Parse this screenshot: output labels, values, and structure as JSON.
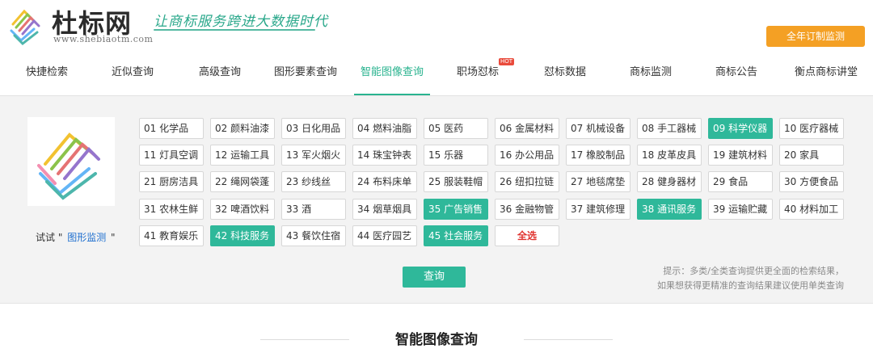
{
  "header": {
    "logo_title": "杜标网",
    "logo_domain": "www.shebiaotm.com",
    "slogan": "让商标服务跨进大数据时代",
    "cta_label": "全年订制监测"
  },
  "nav": {
    "items": [
      {
        "label": "快捷检索"
      },
      {
        "label": "近似查询"
      },
      {
        "label": "高级查询"
      },
      {
        "label": "图形要素查询"
      },
      {
        "label": "智能图像查询"
      },
      {
        "label": "职场怼标",
        "badge": "HOT"
      },
      {
        "label": "怼标数据"
      },
      {
        "label": "商标监测"
      },
      {
        "label": "商标公告"
      },
      {
        "label": "衡点商标讲堂"
      }
    ],
    "active_label": "智能图像查询"
  },
  "panel": {
    "try_prefix": "试试",
    "try_link": "图形监测",
    "categories": [
      {
        "label": "01 化学品"
      },
      {
        "label": "02 颜料油漆"
      },
      {
        "label": "03 日化用品"
      },
      {
        "label": "04 燃料油脂"
      },
      {
        "label": "05 医药"
      },
      {
        "label": "06 金属材料"
      },
      {
        "label": "07 机械设备"
      },
      {
        "label": "08 手工器械"
      },
      {
        "label": "09 科学仪器"
      },
      {
        "label": "10 医疗器械"
      },
      {
        "label": "11 灯具空调"
      },
      {
        "label": "12 运输工具"
      },
      {
        "label": "13 军火烟火"
      },
      {
        "label": "14 珠宝钟表"
      },
      {
        "label": "15 乐器"
      },
      {
        "label": "16 办公用品"
      },
      {
        "label": "17 橡胶制品"
      },
      {
        "label": "18 皮革皮具"
      },
      {
        "label": "19 建筑材料"
      },
      {
        "label": "20 家具"
      },
      {
        "label": "21 厨房洁具"
      },
      {
        "label": "22 绳网袋蓬"
      },
      {
        "label": "23 纱线丝"
      },
      {
        "label": "24 布料床单"
      },
      {
        "label": "25 服装鞋帽"
      },
      {
        "label": "26 纽扣拉链"
      },
      {
        "label": "27 地毯席垫"
      },
      {
        "label": "28 健身器材"
      },
      {
        "label": "29 食品"
      },
      {
        "label": "30 方便食品"
      },
      {
        "label": "31 农林生鲜"
      },
      {
        "label": "32 啤酒饮料"
      },
      {
        "label": "33 酒"
      },
      {
        "label": "34 烟草烟具"
      },
      {
        "label": "35 广告销售"
      },
      {
        "label": "36 金融物管"
      },
      {
        "label": "37 建筑修理"
      },
      {
        "label": "38 通讯服务"
      },
      {
        "label": "39 运输贮藏"
      },
      {
        "label": "40 材料加工"
      },
      {
        "label": "41 教育娱乐"
      },
      {
        "label": "42 科技服务"
      },
      {
        "label": "43 餐饮住宿"
      },
      {
        "label": "44 医疗园艺"
      },
      {
        "label": "45 社会服务"
      }
    ],
    "selected": [
      "09 科学仪器",
      "35 广告销售",
      "38 通讯服务",
      "42 科技服务",
      "45 社会服务"
    ],
    "select_all_label": "全选",
    "tip_line1": "提示：多类/全类查询提供更全面的检索结果，",
    "tip_line2": "如果想获得更精准的查询结果建议使用单类查询",
    "query_label": "查询"
  },
  "section": {
    "title": "智能图像查询"
  },
  "colors": {
    "accent_green": "#2fb89a",
    "cta_orange": "#f4a024",
    "select_all_red": "#e0322e",
    "link_blue": "#1e6fcf"
  }
}
